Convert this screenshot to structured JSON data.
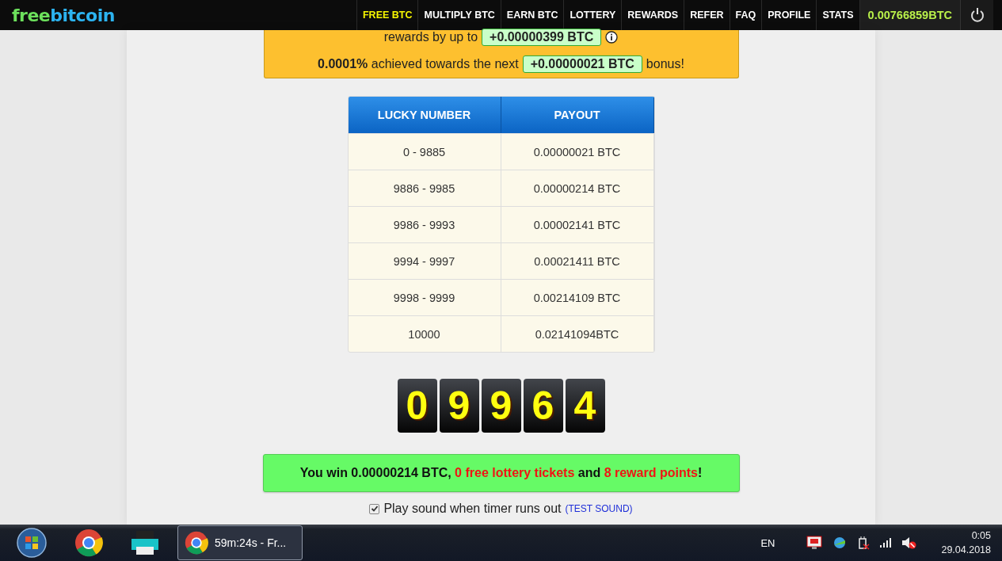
{
  "nav": {
    "logo": {
      "first": "free",
      "second": "bitcoin"
    },
    "items": [
      {
        "label": "FREE BTC",
        "selected": true
      },
      {
        "label": "MULTIPLY BTC",
        "selected": false
      },
      {
        "label": "EARN BTC",
        "selected": false
      },
      {
        "label": "LOTTERY",
        "selected": false
      },
      {
        "label": "REWARDS",
        "selected": false
      },
      {
        "label": "REFER",
        "selected": false
      },
      {
        "label": "FAQ",
        "selected": false
      },
      {
        "label": "PROFILE",
        "selected": false
      },
      {
        "label": "STATS",
        "selected": false
      }
    ],
    "balance": "0.00766859BTC"
  },
  "bonus_box": {
    "line_1": {
      "text": "rewards by up to",
      "amount": "+0.00000399 BTC"
    },
    "line_2": {
      "text": "**0.0001%** achieved towards the next",
      "amount": "+0.00000021 BTC",
      "suffix": "bonus!"
    }
  },
  "payout_table": {
    "columns": [
      "LUCKY NUMBER",
      "PAYOUT"
    ],
    "rows": [
      [
        "0 - 9885",
        "0.00000021 BTC"
      ],
      [
        "9886 - 9985",
        "0.00000214 BTC"
      ],
      [
        "9986 - 9993",
        "0.00002141 BTC"
      ],
      [
        "9994 - 9997",
        "0.00021411 BTC"
      ],
      [
        "9998 - 9999",
        "0.00214109 BTC"
      ],
      [
        "10000",
        "0.02141094BTC"
      ]
    ]
  },
  "digits": [
    "0",
    "9",
    "9",
    "6",
    "4"
  ],
  "result": [
    {
      "kind": "plain",
      "text": "You win 0.00000214 BTC, "
    },
    {
      "kind": "highlight",
      "text": "0 free lottery tickets"
    },
    {
      "kind": "plain",
      "text": " and "
    },
    {
      "kind": "highlight",
      "text": "8 reward points"
    },
    {
      "kind": "plain",
      "text": "!"
    }
  ],
  "sound": {
    "checked": true,
    "label": "Play sound when timer runs out",
    "link": "(TEST SOUND)"
  },
  "taskbar": {
    "task": {
      "label": "59m:24s - Fr...",
      "selected": true
    },
    "language": "EN",
    "time": "0:05",
    "date": "29.04.2018"
  }
}
